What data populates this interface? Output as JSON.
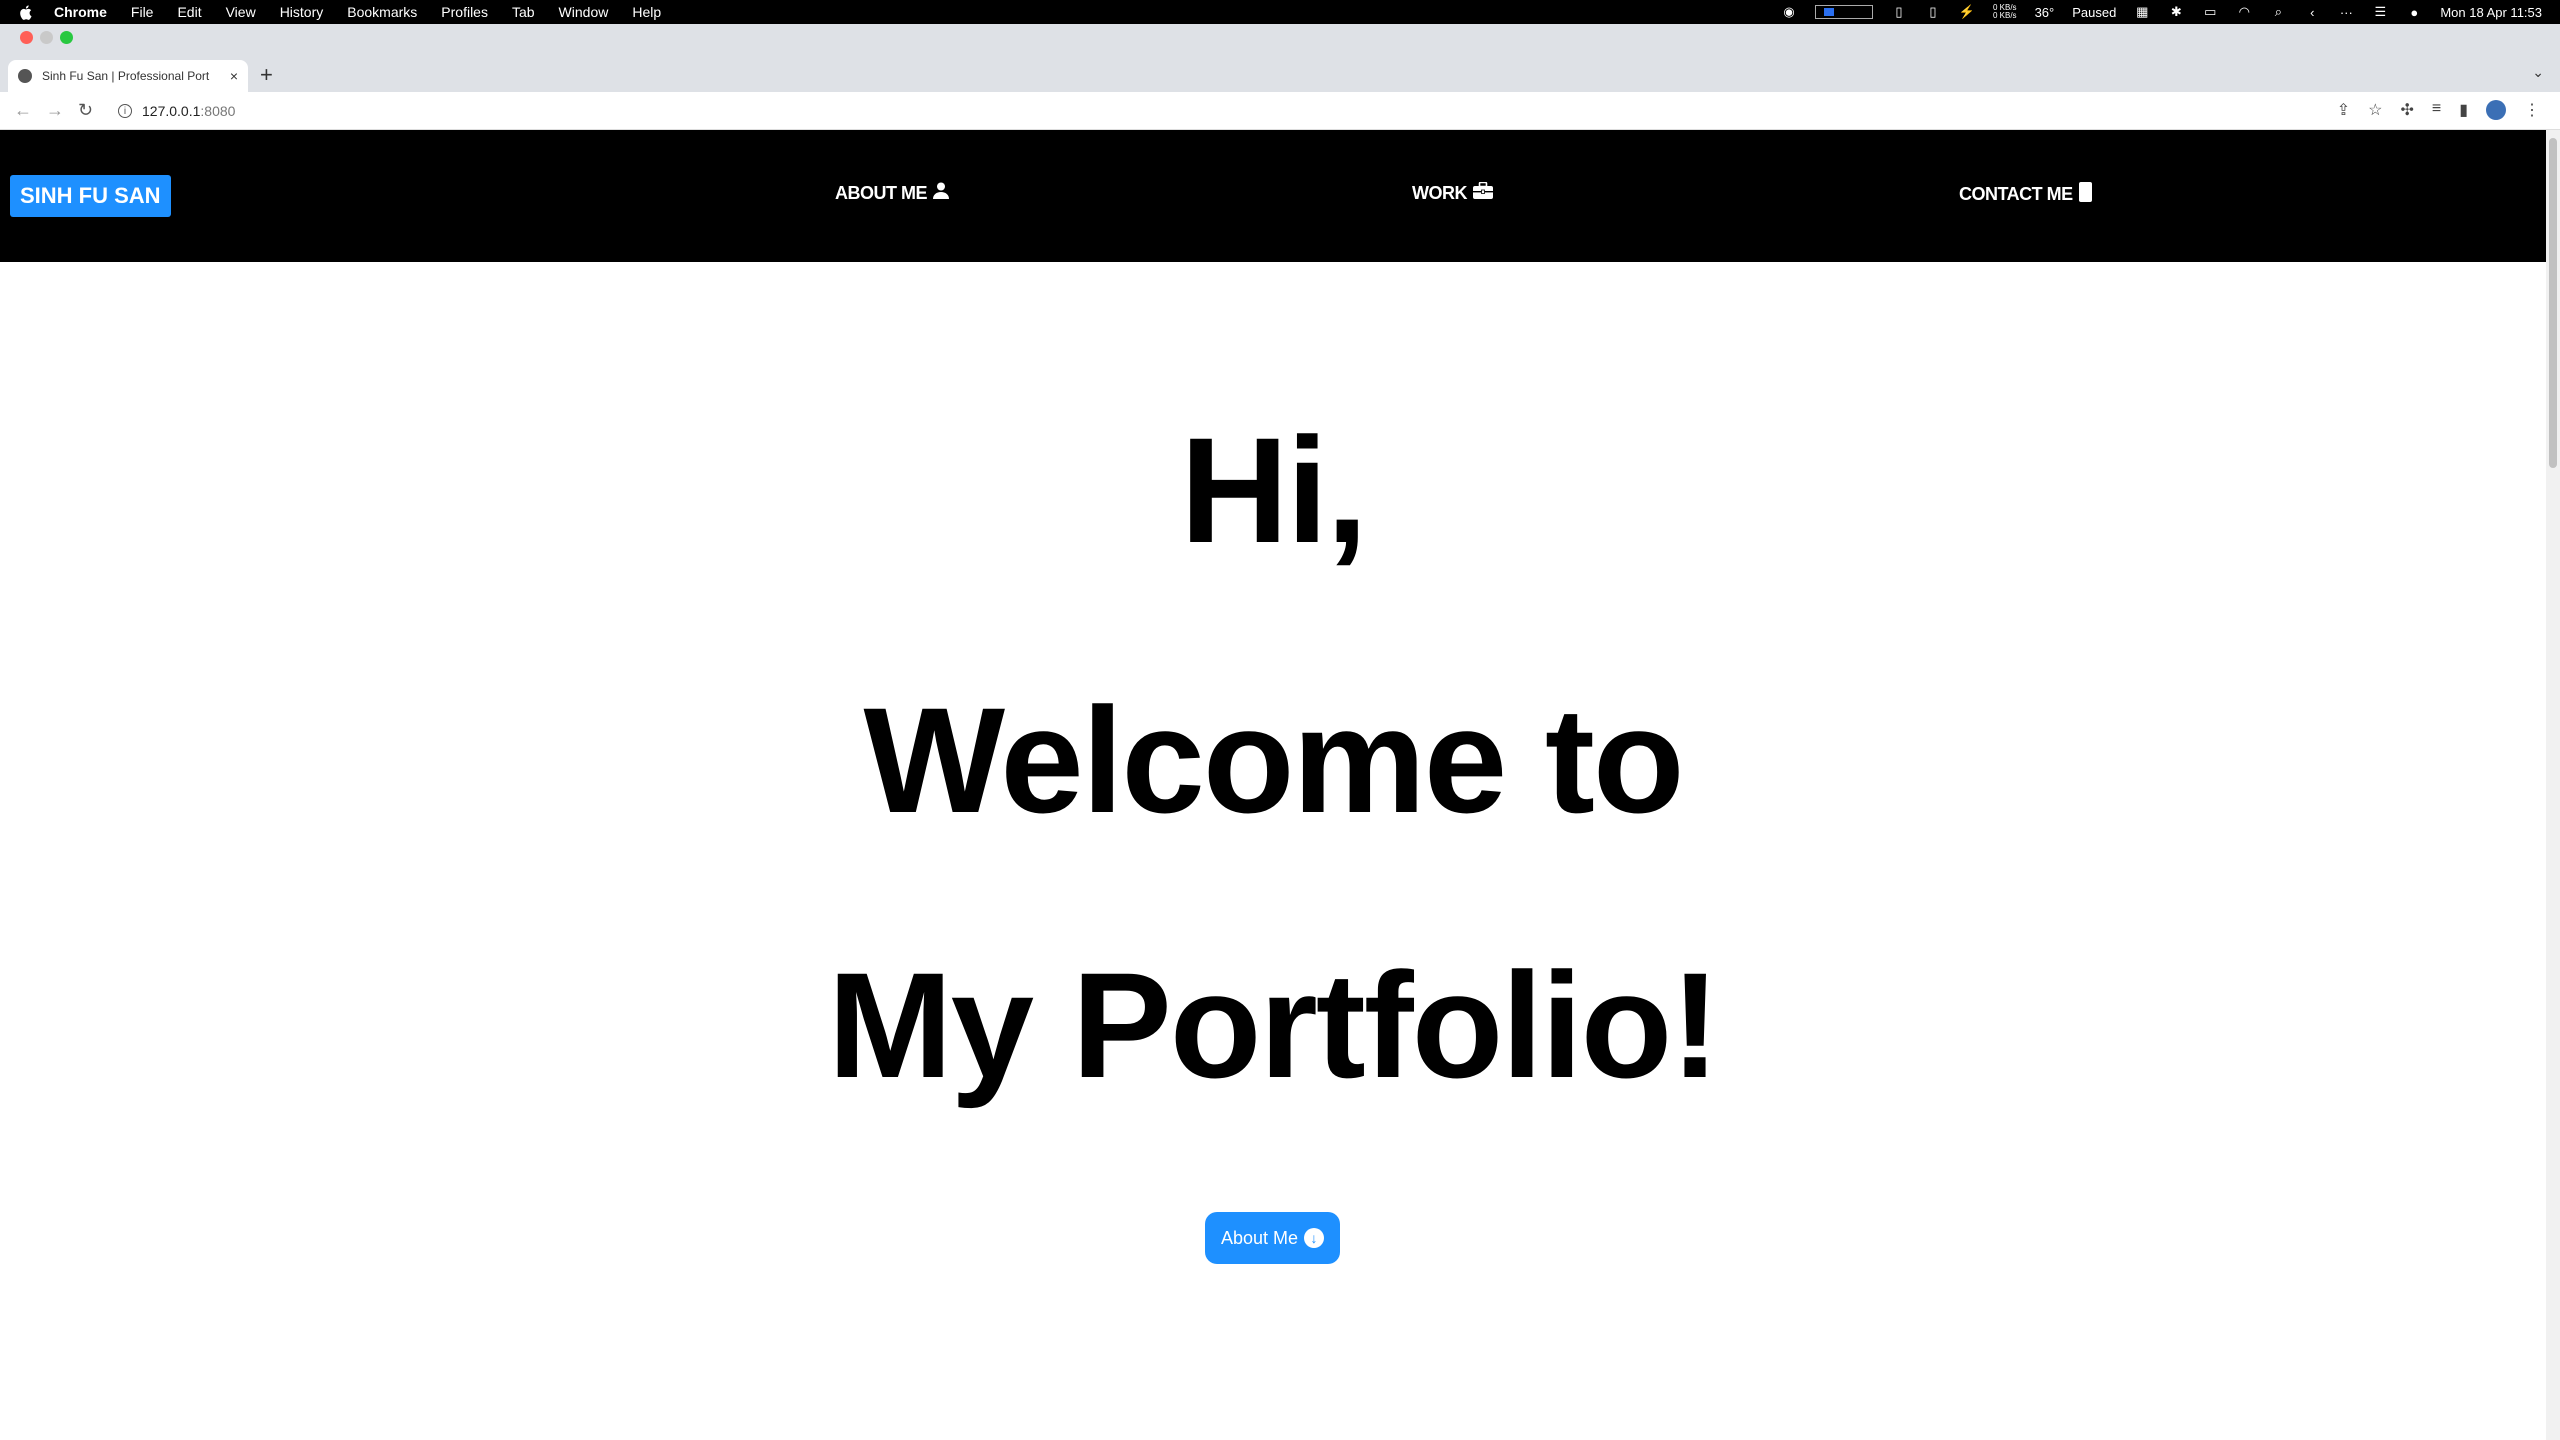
{
  "menubar": {
    "app": "Chrome",
    "items": [
      "File",
      "Edit",
      "View",
      "History",
      "Bookmarks",
      "Profiles",
      "Tab",
      "Window",
      "Help"
    ],
    "net_up": "0 KB/s",
    "net_down": "0 KB/s",
    "temperature": "36°",
    "media_status": "Paused",
    "datetime": "Mon 18 Apr  11:53"
  },
  "browser": {
    "tab_title": "Sinh Fu San | Professional Port",
    "url_host": "127.0.0.1",
    "url_port": ":8080"
  },
  "site": {
    "brand": "SINH FU SAN",
    "nav": {
      "about": "ABOUT ME",
      "work": "WORK",
      "contact": "CONTACT ME"
    },
    "hero": {
      "line1": "Hi,",
      "line2": "Welcome to",
      "line3": "My Portfolio!"
    },
    "cta": "About Me"
  },
  "colors": {
    "accent": "#1e90ff",
    "navbar_bg": "#000000"
  },
  "icons": [
    "apple-icon",
    "user-icon",
    "briefcase-icon",
    "phone-icon",
    "arrow-down-circle-icon"
  ]
}
